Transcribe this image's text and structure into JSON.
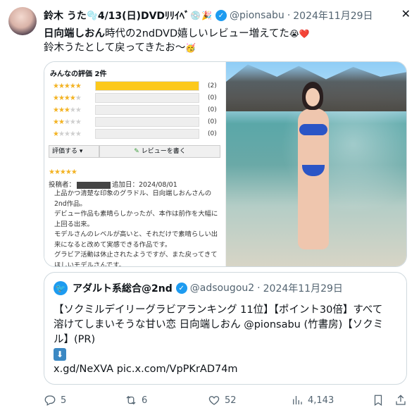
{
  "tweet": {
    "author_name": "鈴木 うた",
    "author_name_suffix": "4/13(日)DVDﾘﾘｲﾍﾞ",
    "handle": "@pionsabu",
    "separator": "·",
    "date": "2024年11月29日",
    "text_line1_bold": "日向端しおん",
    "text_line1_rest": "時代の2ndDVD嬉しいレビュー増えてた",
    "text_line2": "鈴木うたとして戻ってきたお〜"
  },
  "review_image": {
    "title": "みんなの評価 2件",
    "rows": [
      {
        "stars": 5,
        "count": "(2)",
        "fraction": 1.0
      },
      {
        "stars": 4,
        "count": "(0)",
        "fraction": 0
      },
      {
        "stars": 3,
        "count": "(0)",
        "fraction": 0
      },
      {
        "stars": 2,
        "count": "(0)",
        "fraction": 0
      },
      {
        "stars": 1,
        "count": "(0)",
        "fraction": 0
      }
    ],
    "rate_label": "評価する ▾",
    "write_label": "レビューを書く",
    "review_stars": "★★★★★",
    "poster_label": "投稿者：",
    "added_label": "追加日：2024/08/01",
    "body": [
      "上品かつ清楚な印象のグラドル、日向端しおんさんの",
      "2nd作品。",
      "デビュー作品も素晴らしかったが、本作は前作を大幅に",
      "上回る出来。",
      "モデルさんのレベルが高いと、それだけで素晴らしい出",
      "来になると改めて実感できる作品です。",
      "グラビア活動は休止されたようですが、また戻ってきて",
      "ほしいモデルさんです。"
    ]
  },
  "quote": {
    "author_name": "アダルト系総合@2nd",
    "handle": "@adsougou2",
    "separator": "·",
    "date": "2024年11月29日",
    "line1": "【ソクミルデイリーグラビアランキング 11位】【ポイント30倍】すべて",
    "line2": "溶けてしまいそうな甘い恋 日向端しおん @pionsabu (竹書房)【ソクミ",
    "line3": "ル】(PR)",
    "arrow": "⬇",
    "links": "x.gd/NeXVA pic.x.com/VpPKrAD74m"
  },
  "actions": {
    "replies": "5",
    "reposts": "6",
    "likes": "52",
    "views": "4,143"
  },
  "colors": {
    "verified": "#1d9bf0",
    "muted": "#536471",
    "star": "#f3b323",
    "bar_fill": "#fcc91c"
  }
}
